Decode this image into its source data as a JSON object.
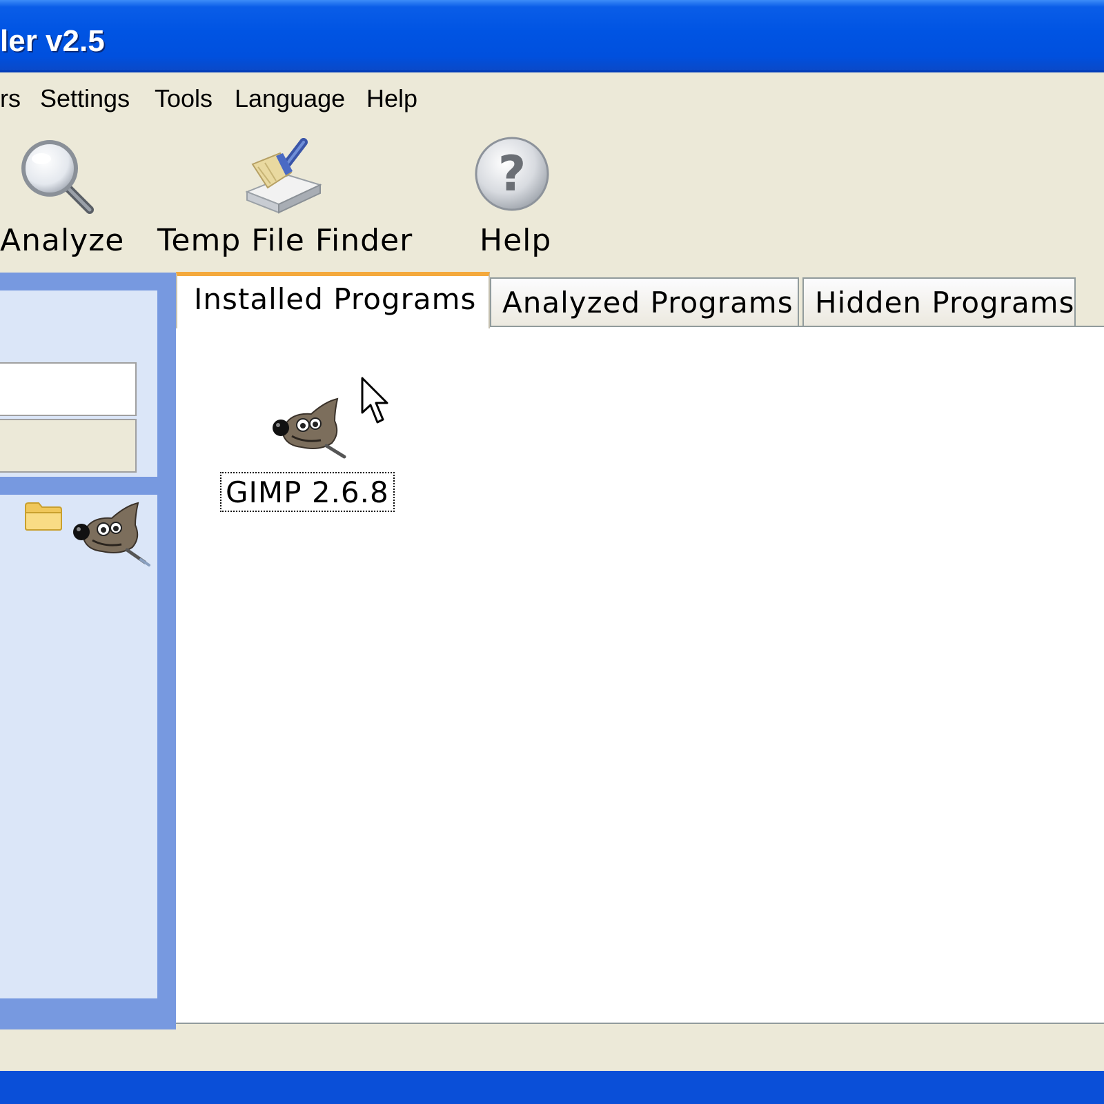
{
  "window": {
    "title": "ler v2.5"
  },
  "menu": {
    "items": [
      {
        "label": "rs"
      },
      {
        "label": "Settings"
      },
      {
        "label": "Tools"
      },
      {
        "label": "Language"
      },
      {
        "label": "Help"
      }
    ]
  },
  "toolbar": {
    "analyze_label": "Analyze",
    "temp_file_finder_label": "Temp File Finder",
    "help_label": "Help",
    "analyze_icon": "magnifier-icon",
    "temp_icon": "broom-icon",
    "help_icon": "question-icon"
  },
  "tabs": [
    {
      "label": "Installed Programs",
      "active": true
    },
    {
      "label": "Analyzed Programs",
      "active": false
    },
    {
      "label": "Hidden Programs",
      "active": false
    }
  ],
  "installed_programs": [
    {
      "name": "GIMP 2.6.8",
      "icon": "gimp-wilber-icon",
      "selected": true
    }
  ],
  "colors": {
    "titlebar": "#0054e3",
    "window_face": "#ece9d8",
    "left_panel_frame": "#7799e0",
    "left_panel_box": "#dbe6f8",
    "active_tab_accent": "#f4a93c"
  }
}
